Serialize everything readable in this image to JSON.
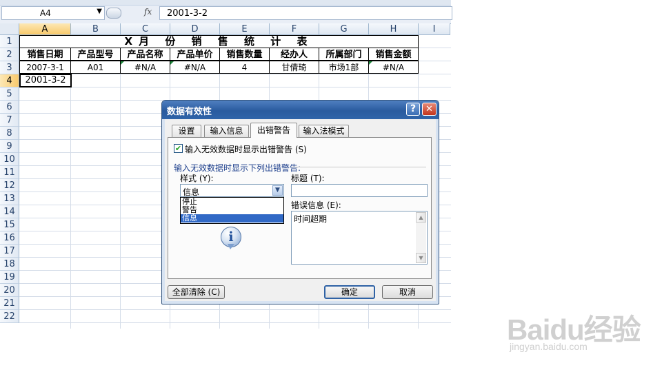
{
  "formula_bar": {
    "name_box": "A4",
    "fx_label": "fx",
    "formula_value": "2001-3-2"
  },
  "sheet": {
    "columns": [
      "A",
      "B",
      "C",
      "D",
      "E",
      "F",
      "G",
      "H",
      "I"
    ],
    "rows": [
      "1",
      "2",
      "3",
      "4",
      "5",
      "6",
      "7",
      "8",
      "9",
      "10",
      "11",
      "12",
      "13",
      "14",
      "15",
      "16",
      "17",
      "18",
      "19",
      "20",
      "21",
      "22"
    ],
    "selected_column": "A",
    "selected_row": "4",
    "title": "X月 份 销 售 统 计 表",
    "headers": [
      "销售日期",
      "产品型号",
      "产品名称",
      "产品单价",
      "销售数量",
      "经办人",
      "所属部门",
      "销售金额"
    ],
    "row3": [
      "2007-3-1",
      "A01",
      "#N/A",
      "#N/A",
      "4",
      "甘倩琦",
      "市场1部",
      "#N/A"
    ],
    "active_cell_value": "2001-3-2"
  },
  "dialog": {
    "title": "数据有效性",
    "help_label": "?",
    "close_label": "✕",
    "tabs": [
      "设置",
      "输入信息",
      "出错警告",
      "输入法模式"
    ],
    "active_tab": "出错警告",
    "show_alert_checkbox": {
      "checked": true,
      "label": "输入无效数据时显示出错警告 (S)"
    },
    "section_label": "输入无效数据时显示下列出错警告:",
    "style_label": "样式 (Y):",
    "style_value": "信息",
    "style_options": [
      "停止",
      "警告",
      "信息"
    ],
    "title_label": "标题 (T):",
    "title_value": "",
    "error_message_label": "错误信息 (E):",
    "error_message_value": "时间超期",
    "clear_all_button": "全部清除 (C)",
    "ok_button": "确定",
    "cancel_button": "取消"
  },
  "watermark": {
    "main": "Baidu经验",
    "sub": "jingyan.baidu.com"
  },
  "colors": {
    "selection_header": "#f8c96c",
    "dialog_title": "#2a5b9f",
    "dropdown_selected": "#3169c6",
    "error_triangle": "#1d8a3c"
  }
}
